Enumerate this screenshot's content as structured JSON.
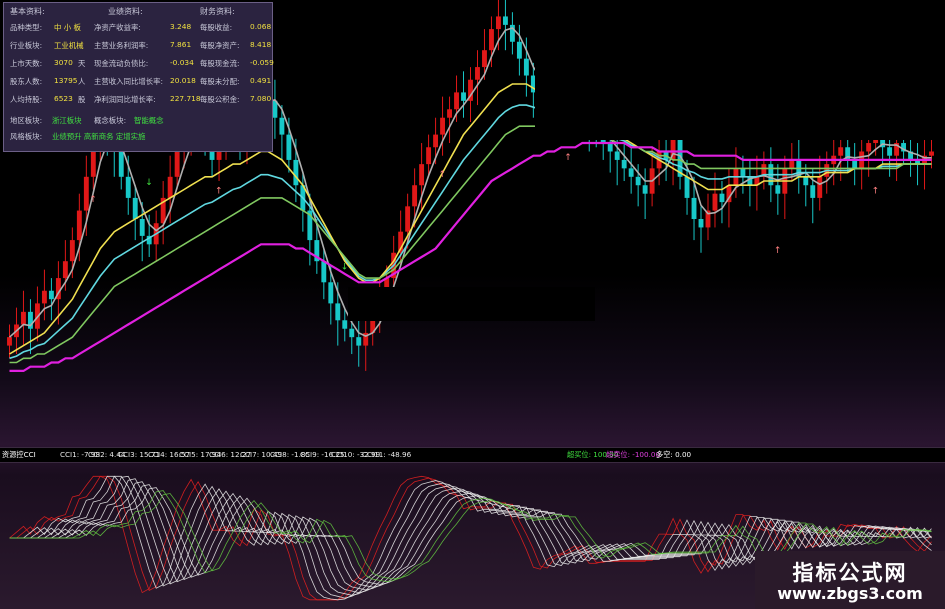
{
  "info_panel": {
    "sections": [
      "基本资料:",
      "业绩资料:",
      "财务资料:"
    ],
    "rows": [
      {
        "l1": "品种类型:",
        "v1": "中 小 板",
        "l2": "净资产收益率:",
        "v2": "3.248",
        "l3": "每股收益:",
        "v3": "0.068"
      },
      {
        "l1": "行业板块:",
        "v1": "工业机械",
        "l2": "主营业务利润率:",
        "v2": "7.861",
        "l3": "每股净资产:",
        "v3": "8.418"
      },
      {
        "l1": "上市天数:",
        "v1": "3070",
        "u1": "天",
        "l2": "现金流动负债比:",
        "v2": "-0.034",
        "l3": "每股现金流:",
        "v3": "-0.059"
      },
      {
        "l1": "股东人数:",
        "v1": "13795",
        "u1": "人",
        "l2": "主营收入同比增长率:",
        "v2": "20.018",
        "l3": "每股未分配:",
        "v3": "0.491"
      },
      {
        "l1": "人均持股:",
        "v1": "6523",
        "u1": "股",
        "l2": "净利润同比增长率:",
        "v2": "227.718",
        "l3": "每股公积金:",
        "v3": "7.080"
      }
    ],
    "region_label": "地区板块:",
    "region": "浙江板块",
    "concept_label": "概念板块:",
    "concept": "智能概念",
    "style_label": "风格板块:",
    "style": "业绩预升 高新商务 定增实施"
  },
  "cci_strip": {
    "title": "资源控CCI",
    "items": [
      "CCI1: -7.98",
      "CCI2: 4.44",
      "CCI3: 15.71",
      "CCI4: 16.57",
      "CCI5: 17.94",
      "CCI6: 12.27",
      "CCI7: 10.49",
      "CCI8: -1.85",
      "CCI9: -16.25",
      "CCI10: -32.99",
      "CCI11: -48.96"
    ],
    "extra": [
      {
        "label": "超买位: 100.00",
        "color": "#40e040"
      },
      {
        "label": "超卖位: -100.00",
        "color": "#e040e0"
      },
      {
        "label": "多空: 0.00",
        "color": "#ffffff"
      }
    ]
  },
  "watermark": {
    "name": "指标公式网",
    "url": "www.zbgs3.com"
  },
  "colors": {
    "up": "#e01818",
    "down": "#18c8c8",
    "ma_yellow": "#f0e050",
    "ma_green": "#80c860",
    "ma_magenta": "#e020e0",
    "ma_cyan": "#60d8e0",
    "ma_gray": "#b0b0b0"
  },
  "chart_data": {
    "type": "candlestick",
    "title": "",
    "price_range": [
      0,
      100
    ],
    "closes": [
      22,
      25,
      28,
      24,
      30,
      33,
      31,
      36,
      40,
      45,
      52,
      60,
      68,
      74,
      70,
      66,
      60,
      55,
      50,
      46,
      44,
      49,
      55,
      60,
      66,
      70,
      74,
      72,
      68,
      64,
      70,
      76,
      73,
      68,
      72,
      79,
      82,
      78,
      74,
      70,
      64,
      58,
      52,
      45,
      40,
      35,
      30,
      26,
      24,
      22,
      20,
      23,
      27,
      31,
      36,
      42,
      47,
      53,
      58,
      63,
      67,
      70,
      74,
      76,
      80,
      78,
      83,
      86,
      90,
      95,
      98,
      96,
      92,
      88,
      84,
      80,
      82,
      85,
      83,
      80,
      78,
      76,
      74,
      72,
      70,
      68,
      66,
      64,
      62,
      60,
      58,
      56,
      62,
      66,
      64,
      70,
      60,
      55,
      50,
      48,
      52,
      56,
      54,
      58,
      62,
      60,
      58,
      60,
      63,
      58,
      56,
      62,
      64,
      60,
      58,
      55,
      60,
      63,
      65,
      67,
      64,
      62,
      66,
      68,
      70,
      67,
      65,
      68,
      66,
      64,
      63,
      65,
      66
    ],
    "ma_yellow": [
      18,
      19,
      20,
      21,
      22,
      23,
      25,
      27,
      29,
      31,
      34,
      37,
      40,
      43,
      45,
      47,
      48,
      49,
      50,
      51,
      52,
      53,
      54,
      55,
      56,
      57,
      58,
      59,
      60,
      60,
      61,
      62,
      63,
      63,
      64,
      65,
      66,
      66,
      65,
      64,
      62,
      60,
      58,
      55,
      52,
      49,
      46,
      43,
      40,
      38,
      36,
      35,
      35,
      36,
      38,
      40,
      43,
      46,
      49,
      52,
      55,
      58,
      61,
      64,
      67,
      70,
      72,
      74,
      76,
      78,
      80,
      81,
      82,
      82,
      82,
      81,
      80,
      80,
      79,
      78,
      77,
      76,
      75,
      74,
      73,
      72,
      71,
      70,
      69,
      68,
      67,
      66,
      65,
      64,
      63,
      62,
      61,
      60,
      59,
      58,
      57,
      57,
      57,
      58,
      58,
      58,
      58,
      58,
      59,
      59,
      59,
      59,
      59,
      60,
      60,
      60,
      60,
      61,
      61,
      61,
      61,
      62,
      62,
      62,
      62,
      63,
      63,
      63,
      63,
      63,
      63,
      63,
      63
    ],
    "ma_green": [
      16,
      16,
      17,
      17,
      18,
      18,
      19,
      20,
      21,
      22,
      24,
      26,
      28,
      30,
      32,
      34,
      35,
      36,
      37,
      38,
      39,
      40,
      41,
      42,
      43,
      44,
      45,
      46,
      47,
      48,
      49,
      50,
      51,
      52,
      53,
      54,
      55,
      55,
      55,
      55,
      54,
      53,
      52,
      51,
      49,
      47,
      45,
      43,
      41,
      39,
      37,
      36,
      36,
      36,
      37,
      38,
      40,
      42,
      44,
      46,
      48,
      50,
      52,
      54,
      56,
      58,
      60,
      62,
      64,
      66,
      68,
      70,
      71,
      72,
      72,
      72,
      72,
      72,
      72,
      72,
      72,
      71,
      71,
      70,
      70,
      69,
      69,
      68,
      68,
      67,
      67,
      66,
      66,
      65,
      65,
      64,
      64,
      63,
      63,
      62,
      62,
      62,
      62,
      62,
      62,
      62,
      62,
      62,
      62,
      62,
      62,
      62,
      62,
      62,
      62,
      62,
      62,
      62,
      62,
      62,
      62,
      62,
      62,
      62,
      62,
      62,
      62,
      62,
      63,
      63,
      63,
      63,
      63
    ],
    "ma_magenta": [
      14,
      14,
      14,
      15,
      15,
      15,
      16,
      16,
      17,
      17,
      18,
      19,
      20,
      21,
      22,
      23,
      24,
      25,
      26,
      27,
      28,
      29,
      30,
      31,
      32,
      33,
      34,
      35,
      36,
      37,
      38,
      39,
      40,
      41,
      42,
      43,
      44,
      44,
      44,
      44,
      44,
      43,
      43,
      42,
      41,
      40,
      39,
      38,
      37,
      36,
      35,
      35,
      35,
      35,
      36,
      37,
      38,
      39,
      40,
      41,
      42,
      43,
      45,
      47,
      49,
      51,
      53,
      55,
      57,
      59,
      60,
      61,
      62,
      63,
      64,
      65,
      65,
      66,
      66,
      67,
      67,
      67,
      68,
      68,
      68,
      68,
      68,
      68,
      68,
      67,
      67,
      67,
      67,
      66,
      66,
      66,
      66,
      66,
      65,
      65,
      65,
      65,
      65,
      65,
      65,
      64,
      64,
      64,
      64,
      64,
      64,
      64,
      64,
      64,
      64,
      64,
      64,
      64,
      64,
      64,
      64,
      64,
      64,
      64,
      64,
      64,
      64,
      64,
      64,
      64,
      64,
      64,
      64
    ],
    "cci_range": [
      -200,
      200
    ]
  }
}
